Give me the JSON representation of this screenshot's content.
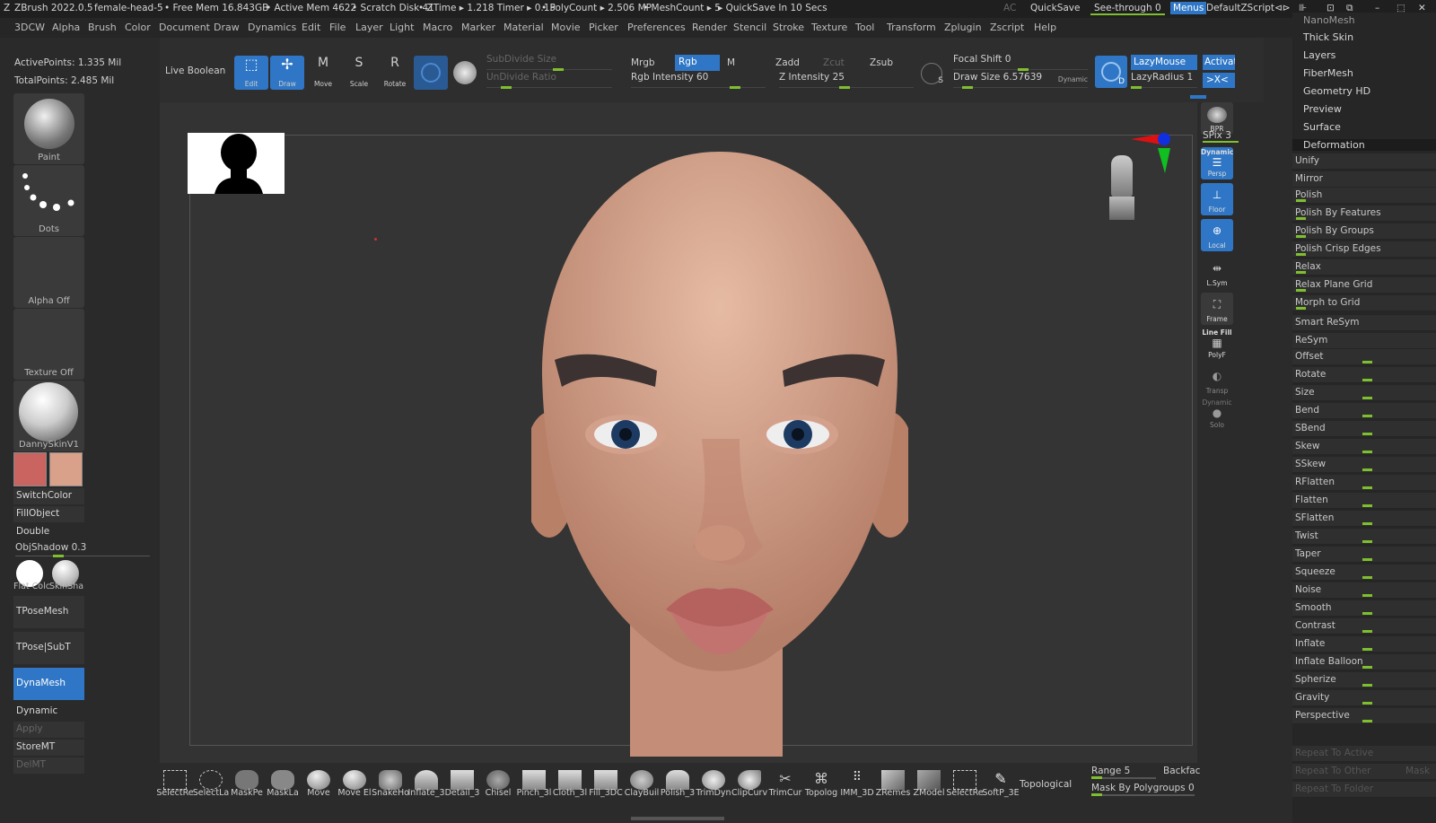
{
  "titlebar": {
    "app": "ZBrush 2022.0.5",
    "doc": "female-head-5",
    "freemem": "• Free Mem 16.843GB",
    "activemem": "• Active Mem 4622",
    "scratch": "• Scratch Disk 41",
    "ztime": "• ZTime ▸ 1.218 Timer ▸ 0.15",
    "poly": "• PolyCount ▸ 2.506 MP",
    "mesh": "• MeshCount ▸ 5",
    "quicksave_info": "▸ QuickSave In 10 Secs",
    "ac": "AC",
    "quicksave": "QuickSave",
    "seethrough": "See-through  0",
    "menus": "Menus",
    "script": "DefaultZScript"
  },
  "menubar": [
    "3DCW",
    "Alpha",
    "Brush",
    "Color",
    "Document",
    "Draw",
    "Dynamics",
    "Edit",
    "File",
    "Layer",
    "Light",
    "Macro",
    "Marker",
    "Material",
    "Movie",
    "Picker",
    "Preferences",
    "Render",
    "Stencil",
    "Stroke",
    "Texture",
    "Tool",
    "Transform",
    "Zplugin",
    "Zscript",
    "Help"
  ],
  "left": {
    "activepoints": "ActivePoints: 1.335 Mil",
    "totalpoints": "TotalPoints: 2.485 Mil",
    "paint": "Paint",
    "dots": "Dots",
    "alpha": "Alpha Off",
    "texture": "Texture Off",
    "material": "DannySkinV1",
    "switchcolor": "SwitchColor",
    "fillobject": "FillObject",
    "double": "Double",
    "objshadow": "ObjShadow",
    "objshadow_val": "0.3",
    "flatcolor": "Flat Colc",
    "skinshade": "SkinSha",
    "tposemesh": "TPoseMesh",
    "tposesubt": "TPose|SubT",
    "dynamesh": "DynaMesh",
    "dynamic": "Dynamic",
    "apply": "Apply",
    "storemt": "StoreMT",
    "delmt": "DelMT",
    "color_main": "#c96460",
    "color_secondary": "#d9a08a"
  },
  "topshelf": {
    "liveboolean": "Live Boolean",
    "edit": "Edit",
    "draw": "Draw",
    "move": "Move",
    "scale": "Scale",
    "rotate": "Rotate",
    "subdividesize": "SubDivide Size",
    "undivideratio": "UnDivide Ratio",
    "mrgb": "Mrgb",
    "rgb": "Rgb",
    "m": "M",
    "rgbintensity": "Rgb Intensity 60",
    "zadd": "Zadd",
    "zcut": "Zcut",
    "zsub": "Zsub",
    "zintensity": "Z Intensity 25",
    "focalshift": "Focal Shift 0",
    "drawsize": "Draw Size 6.57639",
    "dynamic": "Dynamic",
    "lazymouse": "LazyMouse",
    "lazyradius": "LazyRadius 1",
    "activate": "Activat",
    "xlabel": ">X<",
    "s_label": "S",
    "d_label": "D"
  },
  "rightshelf": {
    "bpr": "BPR",
    "spix": "SPix 3",
    "persp_top": "Dynamic",
    "persp": "Persp",
    "floor": "Floor",
    "local": "Local",
    "lsym": "L.Sym",
    "frame": "Frame",
    "linefill": "Line Fill",
    "polyf": "PolyF",
    "transp": "Transp",
    "dynamic2": "Dynamic",
    "solo": "Solo"
  },
  "rightpanel": {
    "headers": [
      "NanoMesh",
      "Thick Skin",
      "Layers",
      "FiberMesh",
      "Geometry HD",
      "Preview",
      "Surface",
      "Deformation"
    ],
    "items": [
      "Unify",
      "Mirror",
      "Polish",
      "Polish By Features",
      "Polish By Groups",
      "Polish Crisp Edges",
      "Relax",
      "Relax Plane Grid",
      "Morph to Grid",
      "Smart ReSym",
      "ReSym",
      "Offset",
      "Rotate",
      "Size",
      "Bend",
      "SBend",
      "Skew",
      "SSkew",
      "RFlatten",
      "Flatten",
      "SFlatten",
      "Twist",
      "Taper",
      "Squeeze",
      "Noise",
      "Smooth",
      "Contrast",
      "Inflate",
      "Inflate Balloon",
      "Spherize",
      "Gravity",
      "Perspective"
    ],
    "repeat_active": "Repeat To Active",
    "repeat_other": "Repeat To Other",
    "mask": "Mask",
    "repeat_folder": "Repeat To Folder"
  },
  "bottom": {
    "brushes": [
      "SelectRe",
      "SelectLa",
      "MaskPe",
      "MaskLa",
      "Move",
      "Move El",
      "SnakeHo",
      "Inflate_3",
      "Detail_3",
      "Chisel",
      "Pinch_3l",
      "Cloth_3l",
      "Fill_3DC",
      "ClayBuil",
      "Polish_3",
      "TrimDyn",
      "ClipCurv",
      "TrimCur",
      "Topolog",
      "IMM_3D",
      "ZRemes",
      "ZModel",
      "SelectRe",
      "SoftP_3E"
    ],
    "topological": "Topological",
    "range": "Range 5",
    "backface": "Backfac",
    "maskpoly": "Mask By Polygroups 0"
  }
}
